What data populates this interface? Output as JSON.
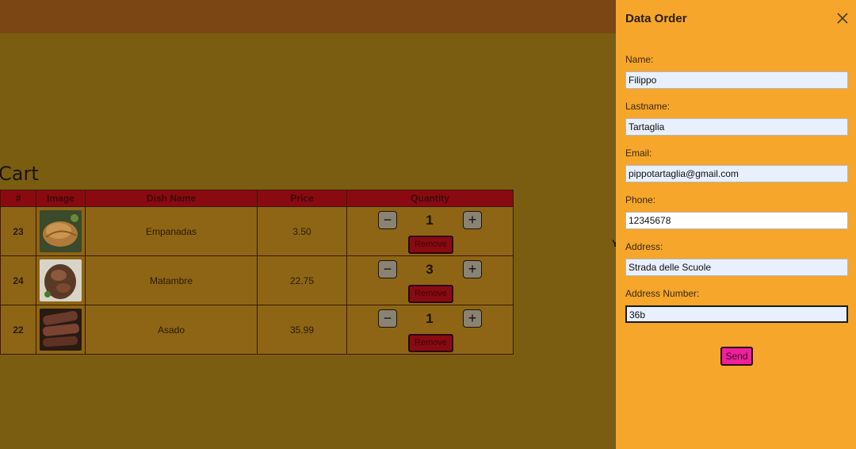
{
  "cart": {
    "title": "Cart",
    "columns": [
      "#",
      "Image",
      "Dish Name",
      "Price",
      "Quantity"
    ],
    "rows": [
      {
        "id": "23",
        "image": "empanadas-photo",
        "name": "Empanadas",
        "price": "3.50",
        "quantity": "1",
        "remove_label": "Remove"
      },
      {
        "id": "24",
        "image": "matambre-photo",
        "name": "Matambre",
        "price": "22.75",
        "quantity": "3",
        "remove_label": "Remove"
      },
      {
        "id": "22",
        "image": "asado-photo",
        "name": "Asado",
        "price": "35.99",
        "quantity": "1",
        "remove_label": "Remove"
      }
    ],
    "minus_symbol": "−",
    "plus_symbol": "+"
  },
  "background_fragment": "Y",
  "order_panel": {
    "title": "Data Order",
    "close_icon": "close-icon",
    "fields": [
      {
        "label": "Name:",
        "value": "Filippo"
      },
      {
        "label": "Lastname:",
        "value": "Tartaglia"
      },
      {
        "label": "Email:",
        "value": "pippotartaglia@gmail.com"
      },
      {
        "label": "Phone:",
        "value": "12345678"
      },
      {
        "label": "Address:",
        "value": "Strada delle Scuole"
      },
      {
        "label": "Address Number:",
        "value": "36b"
      }
    ],
    "send_label": "Send"
  },
  "colors": {
    "navbar": "#7c4614",
    "backdrop": "#7a5d10",
    "panel": "#f5a62b",
    "table_header": "#8a0a12",
    "send_button": "#f01f9b"
  }
}
